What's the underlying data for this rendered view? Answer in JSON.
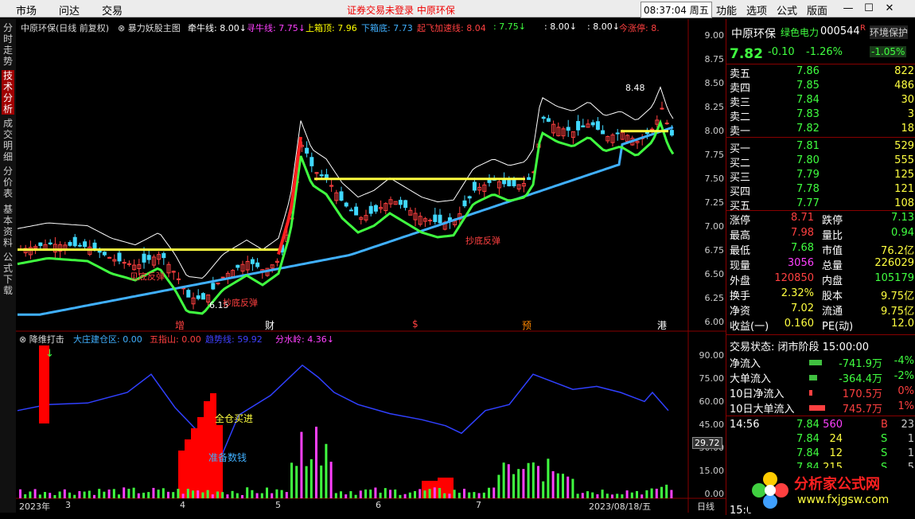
{
  "menubar": {
    "market": "市场",
    "wenda": "问达",
    "trade": "交易",
    "warning": "证券交易未登录",
    "warning_stock": "中原环保",
    "clock": "08:37:04 周五",
    "func": "功能",
    "options": "选项",
    "formula": "公式",
    "layout": "版面",
    "minimize": "—",
    "maximize": "☐",
    "close": "✕"
  },
  "sidebar": [
    "分时走势",
    "技术分析",
    "成交明细",
    "分价表",
    "基本资料",
    "公式下载"
  ],
  "chart": {
    "title": "中原环保(日线 前复权)",
    "indicator": "暴力妖股主图",
    "params": [
      {
        "label": "牵牛线: 8.00↓",
        "color": "#ffffff"
      },
      {
        "label": "寻牛线: 7.75↓",
        "color": "#ff40ff"
      },
      {
        "label": "上箱顶: 7.96",
        "color": "#ffff00"
      },
      {
        "label": "下箱底: 7.73",
        "color": "#40b0ff"
      },
      {
        "label": "起飞加速线: 8.04",
        "color": "#ff4040"
      },
      {
        "label": ": 7.75↓",
        "color": "#40ff40"
      },
      {
        "label": ": 8.00↓",
        "color": "#ffffff"
      },
      {
        "label": ": 8.00↓",
        "color": "#ffffff"
      },
      {
        "label": "今涨停: 8.",
        "color": "#ff4040"
      }
    ],
    "yaxis": [
      "9.00",
      "8.75",
      "8.50",
      "8.25",
      "8.00",
      "7.75",
      "7.50",
      "7.25",
      "7.00",
      "6.75",
      "6.50",
      "6.25",
      "6.00"
    ],
    "annotations": {
      "peak": "8.48",
      "low": "6.15",
      "rebound1": "见底反弹",
      "rebound2": "抄底反弹",
      "rebound3": "抄底反弹"
    },
    "event_marks": [
      {
        "label": "增",
        "color": "#ff4040"
      },
      {
        "label": "财",
        "color": "#ffffff"
      },
      {
        "label": "$",
        "color": "#ff4040"
      },
      {
        "label": "预",
        "color": "#ff8800"
      },
      {
        "label": "港",
        "color": "#ffffff"
      }
    ]
  },
  "sub": {
    "name": "降维打击",
    "params": [
      {
        "label": "大庄建仓区: 0.00",
        "color": "#40b0ff"
      },
      {
        "label": "五指山: 0.00",
        "color": "#ff4040"
      },
      {
        "label": "趋势线: 59.92",
        "color": "#4040ff"
      },
      {
        "label": "分水岭: 4.36↓",
        "color": "#ff40ff"
      }
    ],
    "yaxis": [
      "90.00",
      "75.00",
      "60.00",
      "45.00",
      "30.00",
      "15.00",
      "0.00"
    ],
    "cursor_value": "29.72",
    "buy_label": "全仓买进",
    "prep_label": "准备数钱"
  },
  "xaxis": [
    "2023年",
    "3",
    "4",
    "5",
    "6",
    "7",
    "8",
    "2023/08/18/五"
  ],
  "period": "日线",
  "right": {
    "name": "中原环保",
    "sector": "绿色电力",
    "code": "000544",
    "r_mark": "R",
    "industry": "环境保护",
    "industry_chg": "-1.05%",
    "price": "7.82",
    "change": "-0.10",
    "pct": "-1.26%",
    "asks": [
      {
        "l": "卖五",
        "p": "7.86",
        "v": "822"
      },
      {
        "l": "卖四",
        "p": "7.85",
        "v": "486"
      },
      {
        "l": "卖三",
        "p": "7.84",
        "v": "30"
      },
      {
        "l": "卖二",
        "p": "7.83",
        "v": "3"
      },
      {
        "l": "卖一",
        "p": "7.82",
        "v": "18"
      }
    ],
    "bids": [
      {
        "l": "买一",
        "p": "7.81",
        "v": "529"
      },
      {
        "l": "买二",
        "p": "7.80",
        "v": "555"
      },
      {
        "l": "买三",
        "p": "7.79",
        "v": "125"
      },
      {
        "l": "买四",
        "p": "7.78",
        "v": "121"
      },
      {
        "l": "买五",
        "p": "7.77",
        "v": "108"
      }
    ],
    "stats": [
      [
        "涨停",
        "8.71",
        "跌停",
        "7.13"
      ],
      [
        "最高",
        "7.98",
        "量比",
        "0.94"
      ],
      [
        "最低",
        "7.68",
        "市值",
        "76.2亿"
      ],
      [
        "现量",
        "3056",
        "总量",
        "226029"
      ],
      [
        "外盘",
        "120850",
        "内盘",
        "105179"
      ],
      [
        "换手",
        "2.32%",
        "股本",
        "9.75亿"
      ],
      [
        "净资",
        "7.02",
        "流通",
        "9.75亿"
      ],
      [
        "收益(一)",
        "0.160",
        "PE(动)",
        "12.0"
      ]
    ],
    "trade_status": "交易状态: 闭市阶段 15:00:00",
    "flows": [
      [
        "净流入",
        "-741.9万",
        "-4%"
      ],
      [
        "大单流入",
        "-364.4万",
        "-2%"
      ],
      [
        "10日净流入",
        "170.5万",
        "0%"
      ],
      [
        "10日大单流入",
        "745.7万",
        "1%"
      ]
    ],
    "ticks": [
      [
        "14:56",
        "7.84",
        "560",
        "B",
        "23"
      ],
      [
        "",
        "7.84",
        "24",
        "S",
        "1"
      ],
      [
        "",
        "7.84",
        "12",
        "S",
        "1"
      ],
      [
        "",
        "7.84",
        "215",
        "S",
        "5"
      ]
    ],
    "tick_last_time": "15:0"
  },
  "logo": {
    "text": "分析家公式网",
    "url": "www.fxjgsw.com"
  }
}
